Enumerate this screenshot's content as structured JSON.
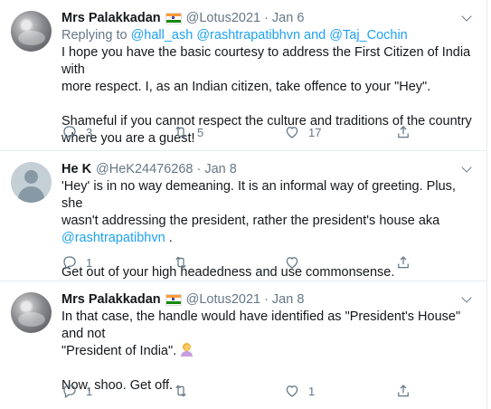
{
  "tweets": [
    {
      "name": "Mrs Palakkadan",
      "handle": "@Lotus2021",
      "date": "Jan 6",
      "has_flag": true,
      "reply_prefix": "Replying to",
      "reply_handles": "@hall_ash @rashtrapatibhvn",
      "reply_and": "and",
      "reply_last": "@Taj_Cochin",
      "lines": [
        "I hope you have the basic courtesy to address the First Citizen of India with",
        "more respect. I, as an Indian citizen, take offence to your \"Hey\".",
        "Shameful if you cannot respect the culture and traditions of the country",
        "where you are a guest!"
      ],
      "replies": "3",
      "retweets": "5",
      "likes": "17"
    },
    {
      "name": "He K",
      "handle": "@HeK24476268",
      "date": "Jan 8",
      "lines": [
        "'Hey' is in no way demeaning. It is an informal way of greeting. Plus, she",
        "wasn't addressing the president, rather the president's house aka",
        "@rashtrapatibhvn",
        ".",
        "Get out of your high headedness and use commonsense."
      ],
      "replies": "1",
      "retweets": "",
      "likes": ""
    },
    {
      "name": "Mrs Palakkadan",
      "handle": "@Lotus2021",
      "date": "Jan 8",
      "has_flag": true,
      "lines": [
        "In that case, the handle would have identified as \"President's House\" and not",
        "\"President of India\".",
        "Now, shoo. Get off."
      ],
      "replies": "1",
      "retweets": "",
      "likes": "1"
    }
  ],
  "dot": "·",
  "colors": {
    "link": "#1da1f2",
    "muted": "#657786",
    "text": "#14171a",
    "divider": "#e6ecf0"
  },
  "icons": [
    "reply-icon",
    "retweet-icon",
    "like-icon",
    "share-icon",
    "caret-down-icon",
    "india-flag-icon",
    "woman-facepalming-emoji"
  ]
}
